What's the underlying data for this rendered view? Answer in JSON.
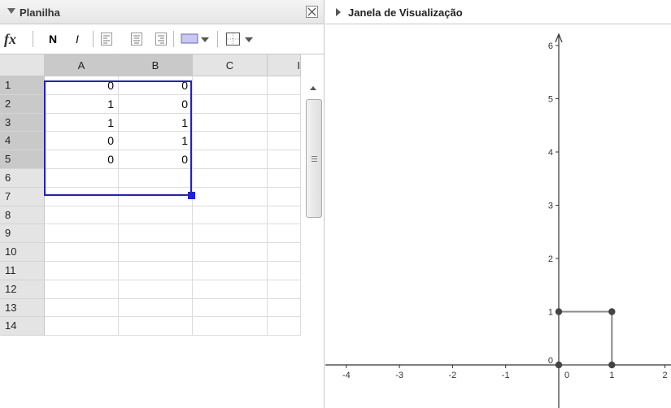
{
  "spreadsheet": {
    "title": "Planilha",
    "toolbar": {
      "fx_label": "fx",
      "bold_label": "N",
      "italic_label": "I"
    },
    "columns": [
      "A",
      "B",
      "C",
      "I"
    ],
    "rows": [
      {
        "num": "1",
        "a": "0",
        "b": "0"
      },
      {
        "num": "2",
        "a": "1",
        "b": "0"
      },
      {
        "num": "3",
        "a": "1",
        "b": "1"
      },
      {
        "num": "4",
        "a": "0",
        "b": "1"
      },
      {
        "num": "5",
        "a": "0",
        "b": "0"
      },
      {
        "num": "6",
        "a": "",
        "b": ""
      },
      {
        "num": "7",
        "a": "",
        "b": ""
      },
      {
        "num": "8",
        "a": "",
        "b": ""
      },
      {
        "num": "9",
        "a": "",
        "b": ""
      },
      {
        "num": "10",
        "a": "",
        "b": ""
      },
      {
        "num": "11",
        "a": "",
        "b": ""
      },
      {
        "num": "12",
        "a": "",
        "b": ""
      },
      {
        "num": "13",
        "a": "",
        "b": ""
      },
      {
        "num": "14",
        "a": "",
        "b": ""
      }
    ],
    "selection_color": "#2020c8"
  },
  "graphics": {
    "title": "Janela de Visualização",
    "chart_data": {
      "type": "scatter",
      "xlim": [
        -4.5,
        2.1
      ],
      "ylim": [
        -0.4,
        6.6
      ],
      "x_ticks": [
        "-4",
        "-3",
        "-2",
        "-1",
        "0",
        "1",
        "2"
      ],
      "y_ticks": [
        "0",
        "1",
        "2",
        "3",
        "4",
        "5",
        "6"
      ],
      "points": [
        {
          "x": 0,
          "y": 0
        },
        {
          "x": 1,
          "y": 0
        },
        {
          "x": 1,
          "y": 1
        },
        {
          "x": 0,
          "y": 1
        }
      ],
      "polygon_color": "#888888",
      "point_color": "#444444"
    }
  }
}
